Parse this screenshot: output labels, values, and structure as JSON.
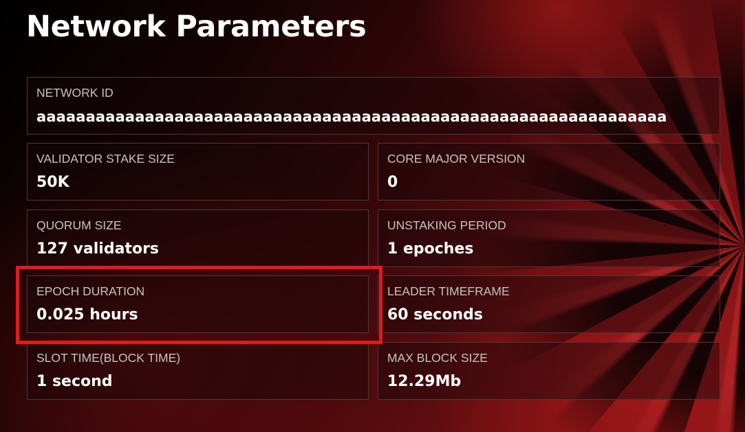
{
  "page": {
    "title": "Network Parameters"
  },
  "parameters": {
    "network_id": {
      "label": "NETWORK ID",
      "value": "aaaaaaaaaaaaaaaaaaaaaaaaaaaaaaaaaaaaaaaaaaaaaaaaaaaaaaaaaaaaaaaa"
    },
    "validator_stake_size": {
      "label": "VALIDATOR STAKE SIZE",
      "value": "50K"
    },
    "core_major_version": {
      "label": "CORE MAJOR VERSION",
      "value": "0"
    },
    "quorum_size": {
      "label": "QUORUM SIZE",
      "value": "127 validators"
    },
    "unstaking_period": {
      "label": "UNSTAKING PERIOD",
      "value": "1 epoches"
    },
    "epoch_duration": {
      "label": "EPOCH DURATION",
      "value": "0.025 hours"
    },
    "leader_timeframe": {
      "label": "LEADER TIMEFRAME",
      "value": "60 seconds"
    },
    "slot_time": {
      "label": "SLOT TIME(BLOCK TIME)",
      "value": "1 second"
    },
    "max_block_size": {
      "label": "MAX BLOCK SIZE",
      "value": "12.29Mb"
    }
  },
  "colors": {
    "highlight": "#e3191f",
    "card_border": "#4d3a3b",
    "label_text": "#c7c2c2",
    "value_text": "#ffffff"
  }
}
